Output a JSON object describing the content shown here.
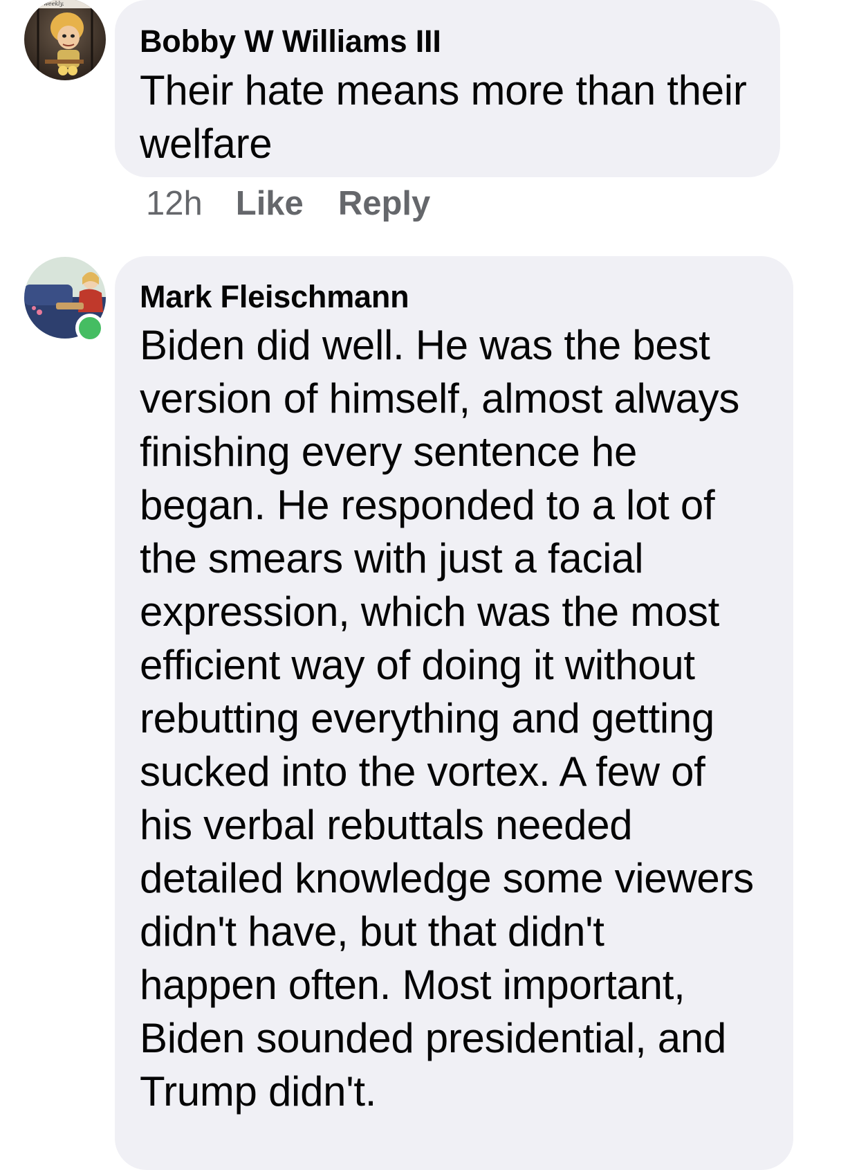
{
  "comments": [
    {
      "author": "Bobby W Williams III",
      "text": "Their hate means more than their\nwelfare",
      "time": "12h",
      "like_label": "Like",
      "reply_label": "Reply",
      "avatar_icon": "profile-photo-cartoon",
      "avatar_text": "weekly."
    },
    {
      "author": "Mark Fleischmann",
      "text": "Biden did well. He was the best\nversion of himself, almost always\nfinishing every sentence he\nbegan. He responded to a lot of\nthe smears with just a facial\nexpression, which was the most\nefficient way of doing it without\nrebutting everything and getting\nsucked into the vortex. A few of\nhis verbal rebuttals needed\ndetailed knowledge some viewers\ndidn't have, but that didn't\nhappen often. Most important,\nBiden sounded presidential, and\nTrump didn't.",
      "avatar_icon": "profile-photo-illustration",
      "online": true
    }
  ],
  "colors": {
    "bubble": "#f0f0f5",
    "meta_text": "#65676b",
    "online_dot": "#45bd62"
  }
}
